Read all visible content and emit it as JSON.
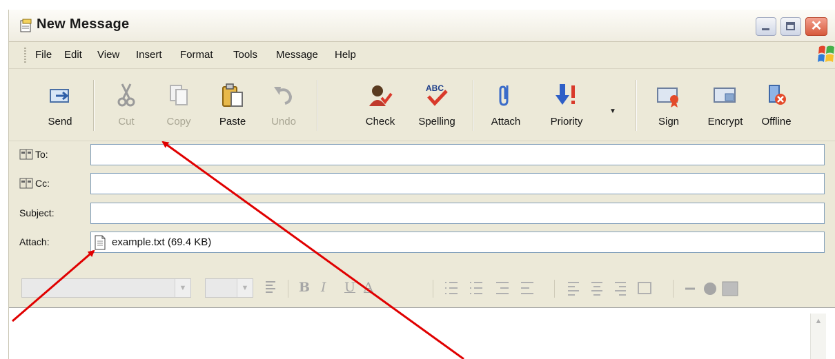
{
  "window": {
    "title": "New Message",
    "close_glyph": "✕"
  },
  "menu": [
    "File",
    "Edit",
    "View",
    "Insert",
    "Format",
    "Tools",
    "Message",
    "Help"
  ],
  "toolbar": [
    {
      "label": "Send",
      "icon": "send-icon",
      "enabled": true
    },
    {
      "label": "Cut",
      "icon": "scissors-icon",
      "enabled": false
    },
    {
      "label": "Copy",
      "icon": "copy-icon",
      "enabled": false
    },
    {
      "label": "Paste",
      "icon": "paste-icon",
      "enabled": true
    },
    {
      "label": "Undo",
      "icon": "undo-icon",
      "enabled": false
    },
    {
      "label": "Check",
      "icon": "check-names-icon",
      "enabled": true
    },
    {
      "label": "Spelling",
      "icon": "spelling-icon",
      "enabled": true
    },
    {
      "label": "Attach",
      "icon": "paperclip-icon",
      "enabled": true
    },
    {
      "label": "Priority",
      "icon": "priority-icon",
      "enabled": true
    },
    {
      "label": "Sign",
      "icon": "sign-icon",
      "enabled": true
    },
    {
      "label": "Encrypt",
      "icon": "encrypt-icon",
      "enabled": true
    },
    {
      "label": "Offline",
      "icon": "offline-icon",
      "enabled": true
    }
  ],
  "fields": {
    "to": {
      "label": "To:",
      "value": ""
    },
    "cc": {
      "label": "Cc:",
      "value": ""
    },
    "subject": {
      "label": "Subject:",
      "value": ""
    },
    "attach": {
      "label": "Attach:",
      "file": "example.txt (69.4 KB)"
    }
  },
  "format_bar": {
    "bold": "B",
    "italic": "I",
    "underline": "U",
    "font_color": "A",
    "enabled": false
  },
  "colors": {
    "annotation_arrow": "#e00000",
    "input_border": "#7f9db9",
    "window_bg": "#ece9d8"
  }
}
